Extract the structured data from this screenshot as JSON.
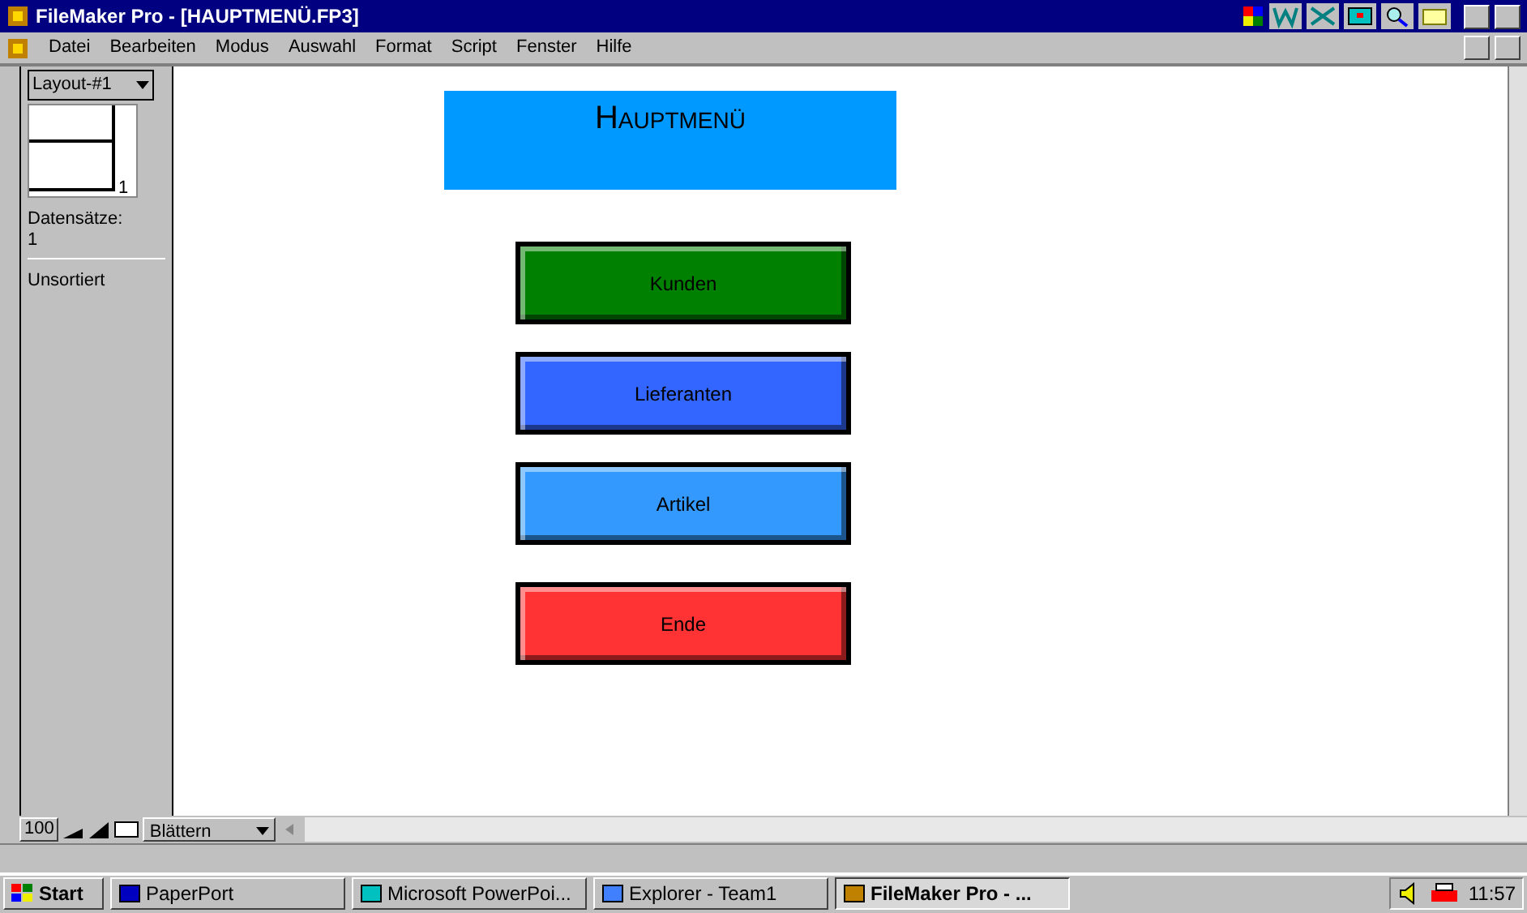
{
  "window": {
    "title": "FileMaker Pro - [HAUPTMENÜ.FP3]"
  },
  "menu": [
    "Datei",
    "Bearbeiten",
    "Modus",
    "Auswahl",
    "Format",
    "Script",
    "Fenster",
    "Hilfe"
  ],
  "sidebar": {
    "layout": "Layout-#1",
    "record_number": "1",
    "records_label": "Datensätze:",
    "records_count": "1",
    "sort_state": "Unsortiert"
  },
  "header": {
    "title": "Hauptmenü"
  },
  "buttons": [
    {
      "label": "Kunden",
      "color": "#008000"
    },
    {
      "label": "Lieferanten",
      "color": "#3366ff"
    },
    {
      "label": "Artikel",
      "color": "#3399ff"
    },
    {
      "label": "Ende",
      "color": "#ff3333"
    }
  ],
  "status": {
    "zoom": "100",
    "mode": "Blättern"
  },
  "taskbar": {
    "start": "Start",
    "tasks": [
      {
        "label": "PaperPort",
        "selected": false
      },
      {
        "label": "Microsoft PowerPoi...",
        "selected": false
      },
      {
        "label": "Explorer - Team1",
        "selected": false
      },
      {
        "label": "FileMaker Pro - ...",
        "selected": true
      }
    ],
    "clock": "11:57"
  }
}
